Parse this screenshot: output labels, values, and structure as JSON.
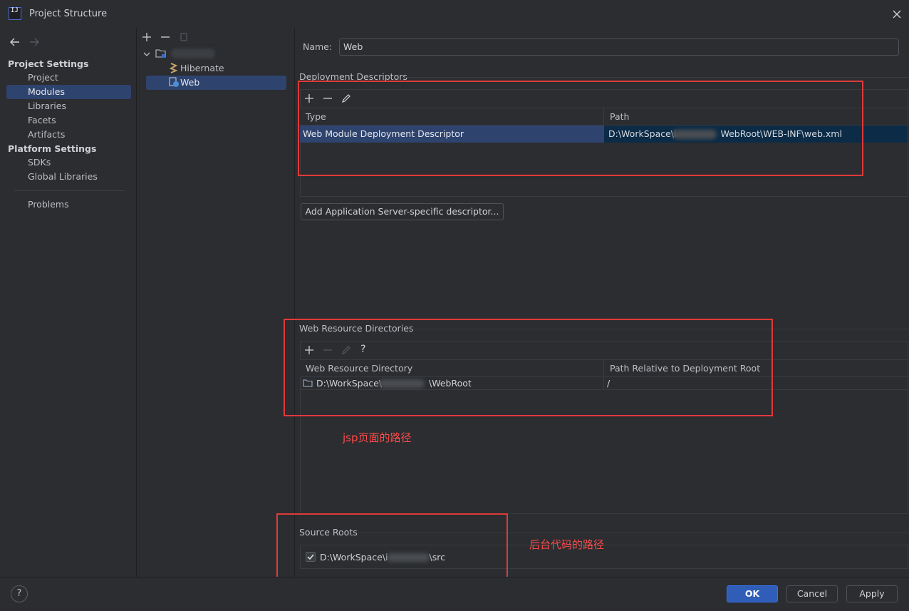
{
  "window": {
    "title": "Project Structure"
  },
  "nav": {
    "project_settings": "Project Settings",
    "project_items": [
      "Project",
      "Modules",
      "Libraries",
      "Facets",
      "Artifacts"
    ],
    "platform_settings": "Platform Settings",
    "platform_items": [
      "SDKs",
      "Global Libraries"
    ],
    "problems": "Problems",
    "selected": "Modules"
  },
  "tree": {
    "facets": [
      "Hibernate",
      "Web"
    ],
    "selected": "Web"
  },
  "web": {
    "name_label": "Name:",
    "name_value": "Web",
    "deployment": {
      "title": "Deployment Descriptors",
      "columns": [
        "Type",
        "Path"
      ],
      "rows": [
        {
          "type": "Web Module Deployment Descriptor",
          "path_prefix": "D:\\WorkSpace\\i",
          "path_suffix": "WebRoot\\WEB-INF\\web.xml"
        }
      ],
      "add_button": "Add Application Server-specific descriptor..."
    },
    "resources": {
      "title": "Web Resource Directories",
      "help": "?",
      "columns": [
        "Web Resource Directory",
        "Path Relative to Deployment Root"
      ],
      "rows": [
        {
          "dir_prefix": "D:\\WorkSpace\\",
          "dir_suffix": "\\WebRoot",
          "relative": "/"
        }
      ]
    },
    "source_roots": {
      "title": "Source Roots",
      "items": [
        {
          "prefix": "D:\\WorkSpace\\i",
          "suffix": "\\src",
          "checked": true
        }
      ]
    }
  },
  "annotations": {
    "jsp_path": "jsp页面的路径",
    "backend_path": "后台代码的路径",
    "color": "#e03a3a"
  },
  "buttons": {
    "help": "?",
    "ok": "OK",
    "cancel": "Cancel",
    "apply": "Apply"
  },
  "colors": {
    "selection": "#2e436e",
    "accent": "#2f5db8",
    "background": "#2b2d30"
  }
}
